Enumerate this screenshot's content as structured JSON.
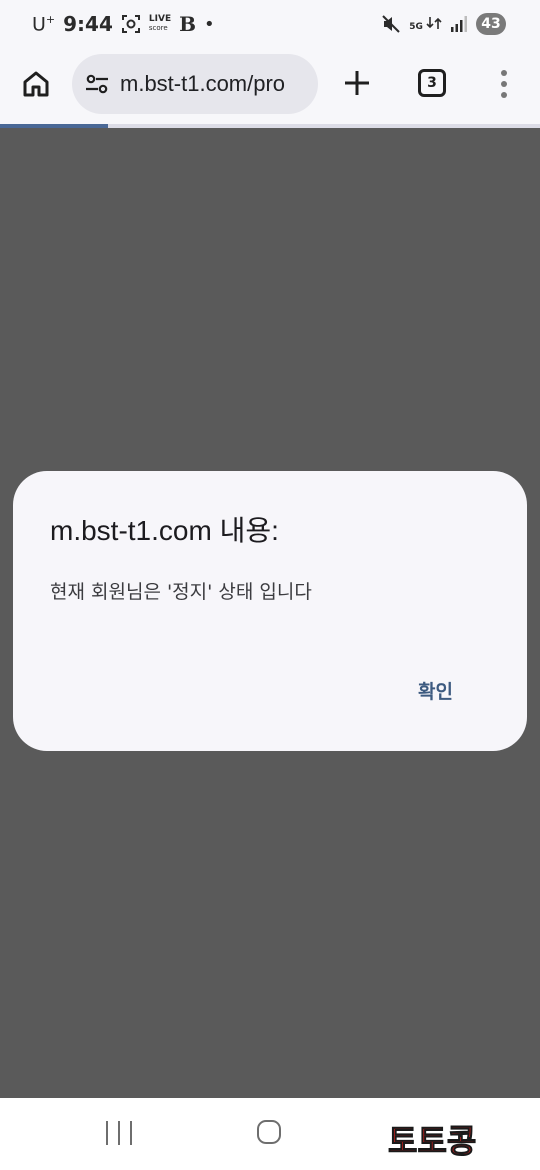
{
  "status_bar": {
    "carrier": "U",
    "carrier_sup": "+",
    "time": "9:44",
    "live_top": "LIVE",
    "live_bottom": "score",
    "app_logo": "B",
    "dot": "•",
    "network": "5G",
    "battery": "43"
  },
  "browser": {
    "url": "m.bst-t1.com/pro",
    "tab_count": "3",
    "load_progress": 0.2
  },
  "dialog": {
    "title": "m.bst-t1.com 내용:",
    "message": "현재 회원님은 '정지' 상태 입니다",
    "ok_label": "확인"
  },
  "watermark": {
    "text": "토토콩"
  },
  "colors": {
    "page_overlay": "#5a5a5a",
    "dialog_bg": "#f7f6fa",
    "accent": "#3d5a80",
    "watermark": "#e5201a"
  }
}
